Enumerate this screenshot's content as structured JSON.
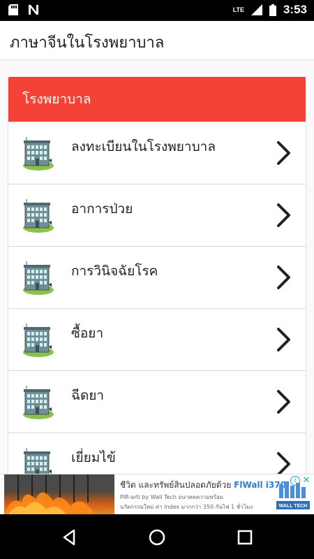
{
  "status_bar": {
    "time": "3:53",
    "network": "LTE",
    "icons": [
      "sd-card-icon",
      "n-notification-icon",
      "wifi-icon",
      "signal-icon",
      "battery-icon"
    ]
  },
  "app_bar": {
    "title": "ภาษาจีนในโรงพยาบาล"
  },
  "section": {
    "header": "โรงพยาบาล",
    "header_color": "#f44336",
    "items": [
      {
        "label": "ลงทะเบียนในโรงพยาบาล",
        "icon": "hospital-building-icon"
      },
      {
        "label": "อาการป่วย",
        "icon": "hospital-building-icon"
      },
      {
        "label": "การวินิจฉัยโรค",
        "icon": "hospital-building-icon"
      },
      {
        "label": "ซื้อยา",
        "icon": "hospital-building-icon"
      },
      {
        "label": "ฉีดยา",
        "icon": "hospital-building-icon"
      },
      {
        "label": "เยี่ยมไข้",
        "icon": "hospital-building-icon"
      }
    ]
  },
  "ad": {
    "line1_prefix": "ชีวิต และทรัพย์สินปลอดภัยด้วย",
    "line1_brand": "FlWall i370",
    "line2": "PIR-arti by Wall Tech อนาคตความพร้อม",
    "line3": "นวัตกรรมใหม่ ค่า Index มากกว่า 350 กันไฟ 1 ชั่วโมง",
    "logo_text": "WALL TECH",
    "info_glyph": "i",
    "close_glyph": "✕"
  },
  "nav_bar": {
    "icons": [
      "back-icon",
      "home-icon",
      "recents-icon"
    ]
  }
}
